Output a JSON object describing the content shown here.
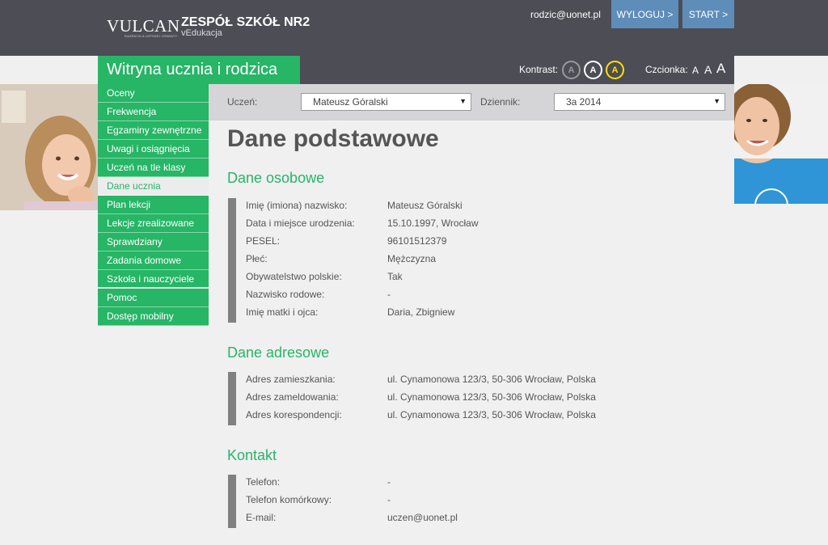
{
  "header": {
    "logo": "VULCAN",
    "logo_tagline": "RAZEM DLA LEPSZEJ OŚWIATY",
    "school_name": "ZESPÓŁ SZKÓŁ NR2",
    "school_sub": "vEdukacja",
    "user_email": "rodzic@uonet.pl",
    "logout_label": "WYLOGUJ >",
    "start_label": "START >"
  },
  "subbar": {
    "site_title": "Witryna ucznia i rodzica",
    "contrast_label": "Kontrast:",
    "contrast_options": [
      "A",
      "A",
      "A"
    ],
    "font_label": "Czcionka:",
    "font_sizes": [
      "A",
      "A",
      "A"
    ]
  },
  "sidebar": {
    "items": [
      {
        "label": "Oceny"
      },
      {
        "label": "Frekwencja"
      },
      {
        "label": "Egzaminy zewnętrzne"
      },
      {
        "label": "Uwagi i osiągnięcia"
      },
      {
        "label": "Uczeń na tle klasy"
      },
      {
        "label": "Dane ucznia",
        "active": true
      },
      {
        "label": "Plan lekcji"
      },
      {
        "label": "Lekcje zrealizowane"
      },
      {
        "label": "Sprawdziany"
      },
      {
        "label": "Zadania domowe"
      },
      {
        "label": "Szkoła i nauczyciele"
      },
      {
        "label": "Pomoc"
      },
      {
        "label": "Dostęp mobilny"
      }
    ]
  },
  "selector": {
    "student_label": "Uczeń:",
    "student_value": "Mateusz Góralski",
    "journal_label": "Dziennik:",
    "journal_value": "3a 2014"
  },
  "content": {
    "page_title": "Dane podstawowe",
    "sections": [
      {
        "title": "Dane osobowe",
        "rows": [
          {
            "label": "Imię (imiona) nazwisko:",
            "value": "Mateusz Góralski"
          },
          {
            "label": "Data i miejsce urodzenia:",
            "value": "15.10.1997, Wrocław"
          },
          {
            "label": "PESEL:",
            "value": "96101512379"
          },
          {
            "label": "Płeć:",
            "value": "Mężczyzna"
          },
          {
            "label": "Obywatelstwo polskie:",
            "value": "Tak"
          },
          {
            "label": "Nazwisko rodowe:",
            "value": "-"
          },
          {
            "label": "Imię matki i ojca:",
            "value": "Daria, Zbigniew"
          }
        ]
      },
      {
        "title": "Dane adresowe",
        "rows": [
          {
            "label": "Adres zamieszkania:",
            "value": "ul. Cynamonowa 123/3, 50-306 Wrocław, Polska"
          },
          {
            "label": "Adres zameldowania:",
            "value": "ul. Cynamonowa 123/3, 50-306 Wrocław, Polska"
          },
          {
            "label": "Adres korespondencji:",
            "value": "ul. Cynamonowa 123/3, 50-306 Wrocław, Polska"
          }
        ]
      },
      {
        "title": "Kontakt",
        "rows": [
          {
            "label": "Telefon:",
            "value": "-"
          },
          {
            "label": "Telefon komórkowy:",
            "value": "-"
          },
          {
            "label": "E-mail:",
            "value": "uczen@uonet.pl"
          }
        ]
      }
    ]
  },
  "colors": {
    "green": "#27b566",
    "header_bg": "#4d4d55",
    "button_blue": "#5e8db9",
    "gray_bar": "#808080"
  }
}
